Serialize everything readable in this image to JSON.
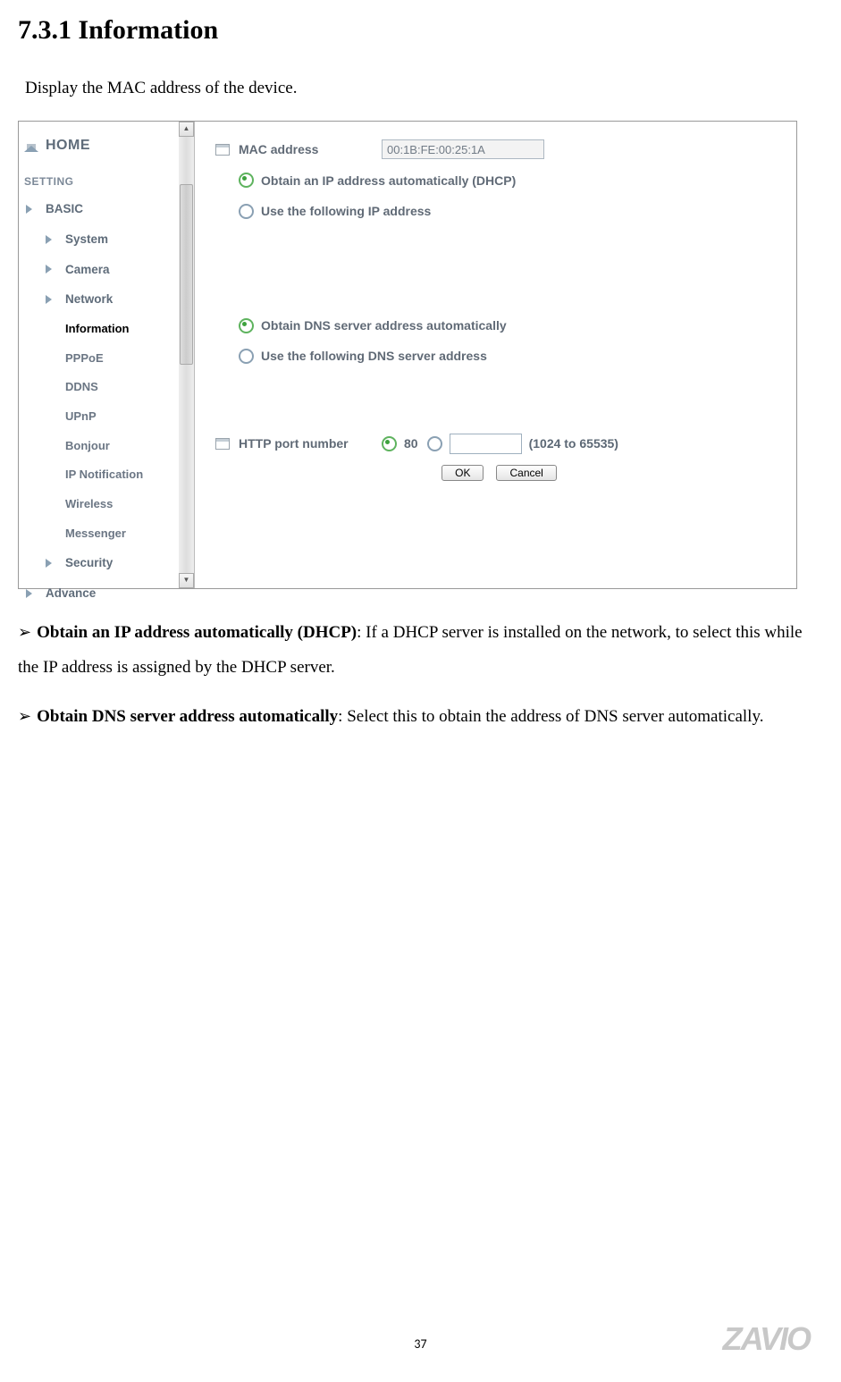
{
  "heading": "7.3.1 Information",
  "intro": "Display the MAC address of the device.",
  "sidebar": {
    "home": "HOME",
    "settingHeader": "SETTING",
    "basic": "BASIC",
    "items": {
      "system": "System",
      "camera": "Camera",
      "network": "Network",
      "security": "Security"
    },
    "networkSub": {
      "information": "Information",
      "pppoe": "PPPoE",
      "ddns": "DDNS",
      "upnp": "UPnP",
      "bonjour": "Bonjour",
      "ipnotif": "IP Notification",
      "wireless": "Wireless",
      "messenger": "Messenger"
    },
    "advance": "Advance"
  },
  "panel": {
    "macLabel": "MAC address",
    "macValue": "00:1B:FE:00:25:1A",
    "ipAuto": "Obtain an IP address automatically (DHCP)",
    "ipManual": "Use the following IP address",
    "dnsAuto": "Obtain DNS server address automatically",
    "dnsManual": "Use the following DNS server address",
    "httpLabel": "HTTP port number",
    "port80": "80",
    "portHint": "(1024 to 65535)",
    "ok": "OK",
    "cancel": "Cancel"
  },
  "paragraphs": {
    "p1bold": "Obtain an IP address automatically (DHCP)",
    "p1rest": ": If a DHCP server is installed on the network, to select this while the IP address is assigned by the DHCP server.",
    "p2bold": "Obtain DNS server address automatically",
    "p2rest": ": Select this to obtain the address of DNS server automatically."
  },
  "pageNumber": "37",
  "logo": "ZAVIO"
}
